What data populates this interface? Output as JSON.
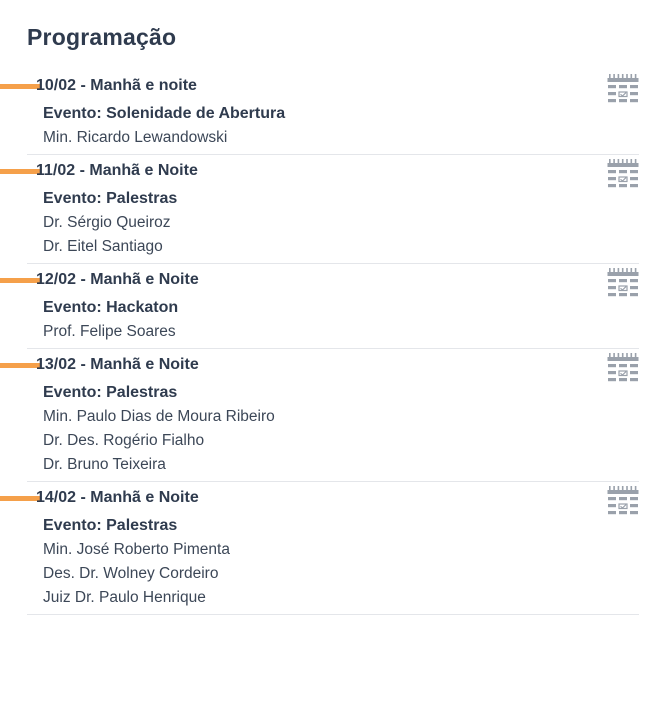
{
  "page": {
    "title": "Programação"
  },
  "colors": {
    "accent": "#f5a04a",
    "text": "#2f3b4e",
    "divider": "#e4e6ea",
    "icon": "#9aa1ab"
  },
  "days": [
    {
      "date": "10/02 - Manhã e noite",
      "event": "Evento: Solenidade de Abertura",
      "speakers": [
        "Min. Ricardo Lewandowski"
      ],
      "icon": "calendar-icon"
    },
    {
      "date": "11/02 - Manhã e Noite",
      "event": "Evento: Palestras",
      "speakers": [
        "Dr. Sérgio Queiroz",
        "Dr. Eitel Santiago"
      ],
      "icon": "calendar-icon"
    },
    {
      "date": "12/02 - Manhã e Noite",
      "event": "Evento: Hackaton",
      "speakers": [
        "Prof. Felipe Soares"
      ],
      "icon": "calendar-icon"
    },
    {
      "date": "13/02 - Manhã e Noite",
      "event": "Evento: Palestras",
      "speakers": [
        "Min. Paulo Dias de Moura Ribeiro",
        "Dr. Des. Rogério Fialho",
        "Dr. Bruno Teixeira"
      ],
      "icon": "calendar-icon"
    },
    {
      "date": "14/02 - Manhã e Noite",
      "event": "Evento: Palestras",
      "speakers": [
        "Min. José Roberto Pimenta",
        "Des. Dr. Wolney Cordeiro",
        "Juiz Dr. Paulo Henrique"
      ],
      "icon": "calendar-icon"
    }
  ]
}
